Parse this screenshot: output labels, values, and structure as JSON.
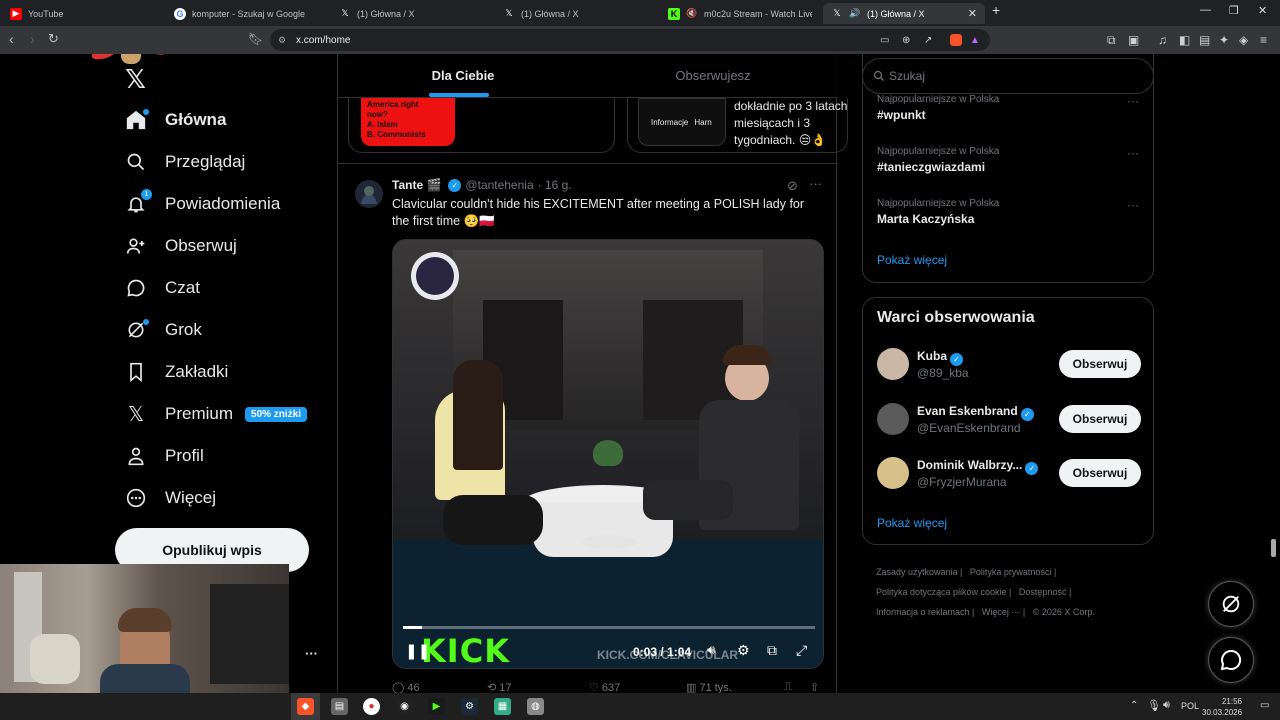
{
  "browser": {
    "tabs": [
      {
        "title": "YouTube",
        "icon": "youtube-icon",
        "color": "#ff0000"
      },
      {
        "title": "komputer - Szukaj w Google",
        "icon": "google-icon",
        "color": "#ffffff"
      },
      {
        "title": "(1) Główna / X",
        "icon": "x-icon",
        "color": "#000000"
      },
      {
        "title": "(1) Główna / X",
        "icon": "x-icon",
        "color": "#000000"
      },
      {
        "title": "m0c2u Stream - Watch Live on Kick",
        "icon": "kick-icon",
        "color": "#53fc18"
      },
      {
        "title": "(1) Główna / X",
        "icon": "x-icon",
        "color": "#000000"
      }
    ],
    "url": "x.com/home"
  },
  "sidebar": {
    "items": [
      {
        "label": "Główna",
        "icon": "home-icon"
      },
      {
        "label": "Przeglądaj",
        "icon": "search-icon"
      },
      {
        "label": "Powiadomienia",
        "icon": "bell-icon",
        "badge": "1"
      },
      {
        "label": "Obserwuj",
        "icon": "follow-icon"
      },
      {
        "label": "Czat",
        "icon": "chat-icon"
      },
      {
        "label": "Grok",
        "icon": "grok-icon"
      },
      {
        "label": "Zakładki",
        "icon": "bookmark-icon"
      },
      {
        "label": "Premium",
        "icon": "x-icon",
        "badge": "50% zniżki"
      },
      {
        "label": "Profil",
        "icon": "profile-icon"
      },
      {
        "label": "Więcej",
        "icon": "more-icon"
      }
    ],
    "post_label": "Opublikuj wpis",
    "account_more": "···"
  },
  "feed": {
    "tabs": [
      "Dla Ciebie",
      "Obserwujesz"
    ],
    "card1_lines": [
      "America right",
      "now?",
      "A. Islam",
      "B. Communists"
    ],
    "card2_label1": "Informacje",
    "card2_label2": "Harn",
    "card2_text": [
      "dokładnie po 3 latach",
      "miesiącach i 3",
      "tygodniach. 😒👌"
    ],
    "tweet": {
      "name": "Tante 🎬",
      "handle": "@tantehenia",
      "time": "· 16 g.",
      "text1": "Clavicular couldn't hide his EXCITEMENT after meeting a POLISH lady for",
      "text2": "the first time 🥺🇵🇱",
      "video_watermark": "KICK.COM/CLAVICULAR",
      "video_time": "0:03 / 1:04",
      "kick_logo": "KICK",
      "progress": 0.047,
      "stats": {
        "replies": "46",
        "reposts": "17",
        "likes": "637",
        "views": "71 tys."
      }
    }
  },
  "right": {
    "search_placeholder": "Szukaj",
    "trends": [
      {
        "sub": "Najpopularniejsze w Polska",
        "name": "#wpunkt"
      },
      {
        "sub": "Najpopularniejsze w Polska",
        "name": "#tanieczgwiazdami"
      },
      {
        "sub": "Najpopularniejsze w Polska",
        "name": "Marta Kaczyńska"
      }
    ],
    "show_more": "Pokaż więcej",
    "who_title": "Warci obserwowania",
    "who": [
      {
        "name": "Kuba",
        "handle": "@89_kba",
        "color": "#c9b6a4"
      },
      {
        "name": "Evan Eskenbrand",
        "handle": "@EvanEskenbrand",
        "color": "#5a5a5a"
      },
      {
        "name": "Dominik Walbrzy...",
        "handle": "@FryzjerMurana",
        "color": "#d8c08a"
      }
    ],
    "follow_label": "Obserwuj",
    "footer": [
      "Zasady użytkowania |",
      "Polityka prywatności |",
      "Polityka dotycząca plików cookie |",
      "Dostępność |",
      "Informacja o reklamach |",
      "Więcej ··· |",
      "© 2026 X Corp."
    ]
  },
  "taskbar": {
    "lang": "POL",
    "time": "21:56",
    "date": "30.03.2026"
  }
}
